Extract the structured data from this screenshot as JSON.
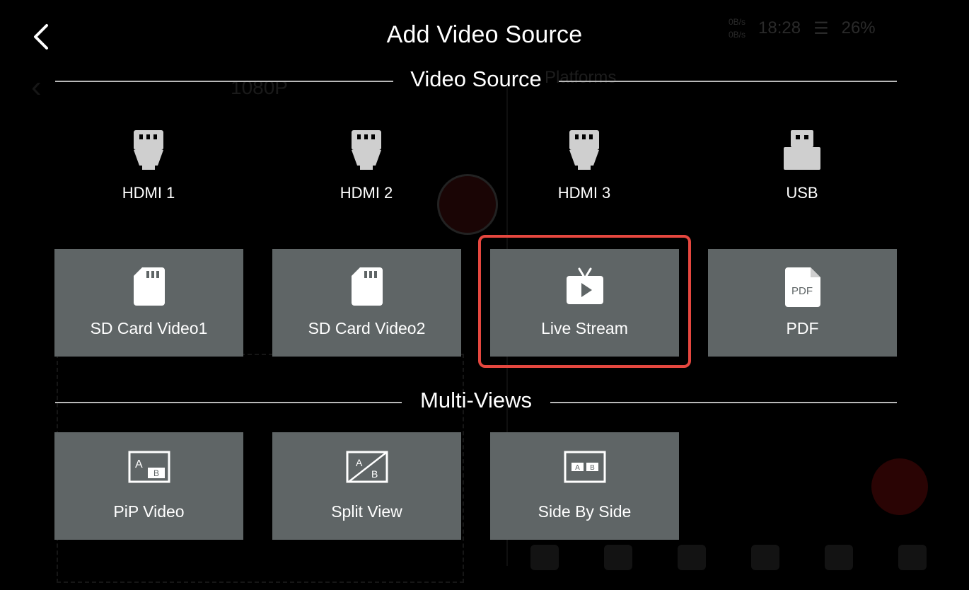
{
  "header": {
    "title": "Add Video Source"
  },
  "background": {
    "rate_up": "0B/s",
    "rate_down": "0B/s",
    "time": "18:28",
    "battery": "26%",
    "resolution": "1080P",
    "platforms": "Platforms"
  },
  "video_source": {
    "heading": "Video Source",
    "inputs": [
      {
        "label": "HDMI 1",
        "icon": "hdmi-icon"
      },
      {
        "label": "HDMI 2",
        "icon": "hdmi-icon"
      },
      {
        "label": "HDMI 3",
        "icon": "hdmi-icon"
      },
      {
        "label": "USB",
        "icon": "usb-icon"
      }
    ],
    "tiles": [
      {
        "label": "SD Card Video1",
        "icon": "sd-card-icon"
      },
      {
        "label": "SD Card Video2",
        "icon": "sd-card-icon"
      },
      {
        "label": "Live Stream",
        "icon": "live-tv-icon"
      },
      {
        "label": "PDF",
        "icon": "pdf-icon"
      }
    ]
  },
  "multi_views": {
    "heading": "Multi-Views",
    "tiles": [
      {
        "label": "PiP Video",
        "icon": "pip-icon",
        "a": "A",
        "b": "B"
      },
      {
        "label": "Split View",
        "icon": "split-view-icon",
        "a": "A",
        "b": "B"
      },
      {
        "label": "Side By Side",
        "icon": "side-by-side-icon",
        "a": "A",
        "b": "B"
      }
    ]
  },
  "colors": {
    "tile_bg": "#5f6566",
    "highlight": "#e5473f",
    "icon_gray": "#cfcfcf"
  }
}
